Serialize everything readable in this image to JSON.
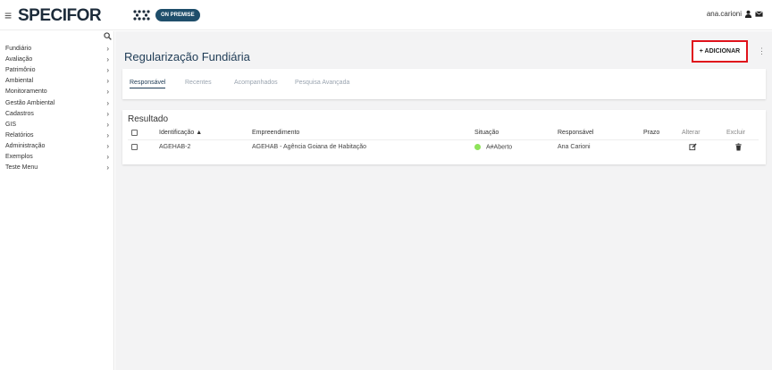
{
  "app": {
    "menu_icon": "hamburger-icon",
    "logo_text": "SPECIFOR",
    "badge": "ON PREMISE",
    "user_name": "ana.carioni",
    "user_icon": "user-icon",
    "mail_icon": "mail-icon"
  },
  "sidebar": {
    "search_icon": "search-icon",
    "items": [
      {
        "label": "Fundiário"
      },
      {
        "label": "Avaliação"
      },
      {
        "label": "Patrimônio"
      },
      {
        "label": "Ambiental"
      },
      {
        "label": "Monitoramento"
      },
      {
        "label": "Gestão Ambiental"
      },
      {
        "label": "Cadastros"
      },
      {
        "label": "GIS"
      },
      {
        "label": "Relatórios"
      },
      {
        "label": "Administração"
      },
      {
        "label": "Exemplos"
      },
      {
        "label": "Teste Menu"
      }
    ]
  },
  "page": {
    "title": "Regularização Fundiária",
    "add_label": "+ ADICIONAR",
    "kebab": "⋮"
  },
  "tabs": [
    {
      "label": "Responsável",
      "active": true
    },
    {
      "label": "Recentes"
    },
    {
      "label": "Acompanhados"
    },
    {
      "label": "Pesquisa Avançada"
    }
  ],
  "results": {
    "title": "Resultado",
    "columns": {
      "identificacao": "Identificação ▲",
      "empreendimento": "Empreendimento",
      "situacao": "Situação",
      "responsavel": "Responsável",
      "prazo": "Prazo",
      "alterar": "Alterar",
      "excluir": "Excluir"
    },
    "rows": [
      {
        "identificacao": "AGEHAB-2",
        "empreendimento": "AGEHAB - Agência Goiana de Habitação",
        "situacao": "A#Aberto",
        "situacao_color": "#8ee35a",
        "responsavel": "Ana Carioni",
        "prazo": "",
        "alterar_icon": "edit-icon",
        "excluir_icon": "trash-icon"
      }
    ]
  },
  "colors": {
    "brand": "#1c2b3a",
    "badge": "#1f4e6b",
    "highlight": "#e0121b",
    "title": "#1f3c56"
  }
}
